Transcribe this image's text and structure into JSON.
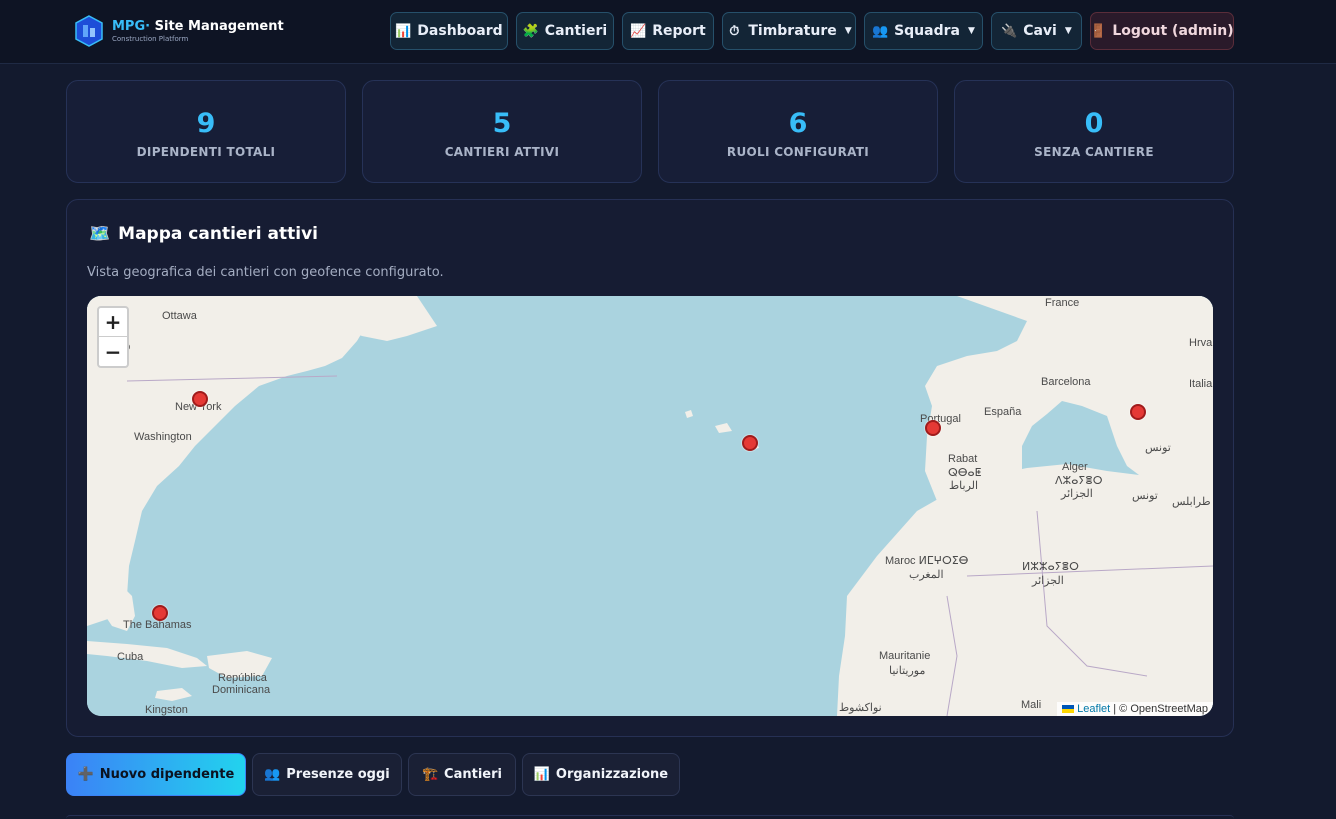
{
  "brand": {
    "prefix": "MPG",
    "separator": "·",
    "title": "Site Management",
    "subtitle": "Construction Platform"
  },
  "nav": {
    "dashboard": "Dashboard",
    "cantieri": "Cantieri",
    "report": "Report",
    "timbrature": "Timbrature",
    "squadra": "Squadra",
    "cavi": "Cavi",
    "logout": "Logout (admin)"
  },
  "stats": [
    {
      "value": "9",
      "label": "DIPENDENTI TOTALI"
    },
    {
      "value": "5",
      "label": "CANTIERI ATTIVI"
    },
    {
      "value": "6",
      "label": "RUOLI CONFIGURATI"
    },
    {
      "value": "0",
      "label": "SENZA CANTIERE"
    }
  ],
  "map_panel": {
    "title": "Mappa cantieri attivi",
    "description": "Vista geografica dei cantieri con geofence configurato.",
    "zoom_in": "+",
    "zoom_out": "−",
    "attribution_leaflet": "Leaflet",
    "attribution_rest": "| © OpenStreetMap",
    "labels": {
      "ottawa": "Ottawa",
      "toronto": "oronto",
      "newyork": "New York",
      "washington": "Washington",
      "bahamas": "The Bahamas",
      "cuba": "Cuba",
      "republica": "República",
      "dominicana": "Dominicana",
      "kingston": "Kingston",
      "france": "France",
      "barcelona": "Barcelona",
      "portugal": "Portugal",
      "espana": "España",
      "italia": "Italia",
      "rabat": "Rabat",
      "rabat_tif": "ⵕⴱⴰⵟ",
      "rabat_ar": "الرباط",
      "alger": "Alger",
      "alger_tif": "ⴷⵣⴰⵢⴻⵔ",
      "alger_ar": "الجزائر",
      "tunis_ar": "تونس",
      "maroc": "Maroc ⵍⵎⵖⵔⵉⴱ",
      "maroc_ar": "المغرب",
      "algerie_tif": "ⵍⵣⵣⴰⵢⴻⵔ",
      "algerie_ar": "الجزائر",
      "mauritanie": "Mauritanie",
      "mauritanie_ar": "موريتانيا",
      "nouakchott_ar": "نواكشوط",
      "mali": "Mali",
      "hrv": "Hrva",
      "tarabulus": "طرابلس",
      "tunis2": "تونس"
    }
  },
  "actions": {
    "nuovo": "Nuovo dipendente",
    "presenze": "Presenze oggi",
    "cantieri": "Cantieri",
    "organizzazione": "Organizzazione"
  },
  "colors": {
    "accent": "#38bdf8",
    "marker": "#e53935",
    "sea": "#aad3df",
    "land": "#f2efe9"
  }
}
